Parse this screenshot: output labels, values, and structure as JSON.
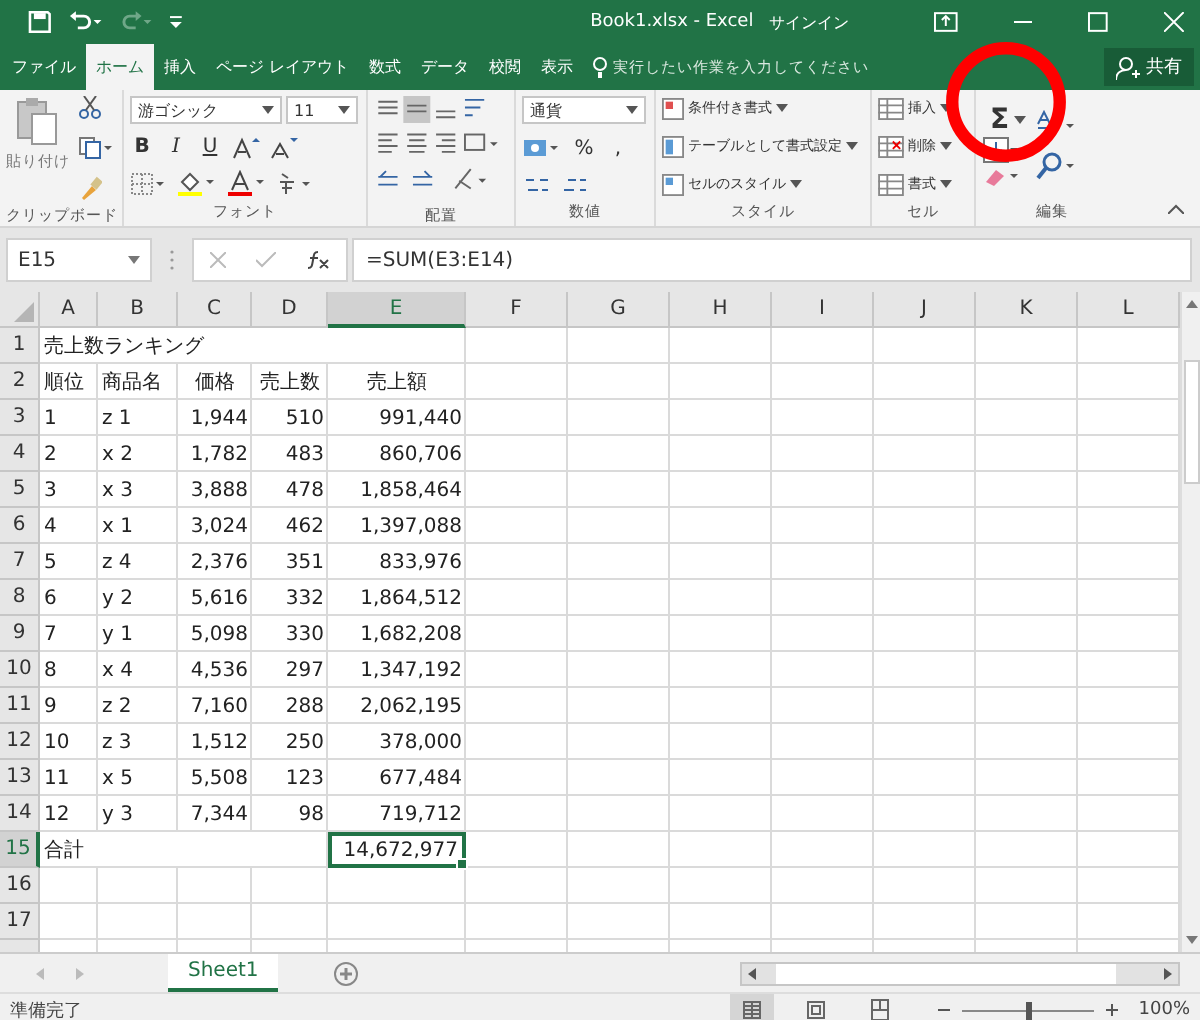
{
  "title_bar": {
    "title": "Book1.xlsx - Excel",
    "signin": "サインイン"
  },
  "ribbon_tabs": [
    {
      "label": "ファイル",
      "selected": false
    },
    {
      "label": "ホーム",
      "selected": true
    },
    {
      "label": "挿入",
      "selected": false
    },
    {
      "label": "ページ レイアウト",
      "selected": false
    },
    {
      "label": "数式",
      "selected": false
    },
    {
      "label": "データ",
      "selected": false
    },
    {
      "label": "校閲",
      "selected": false
    },
    {
      "label": "表示",
      "selected": false
    }
  ],
  "tell_me": {
    "placeholder": "実行したい作業を入力してください"
  },
  "share_button": "共有",
  "clipboard": {
    "paste": "貼り付け",
    "label": "クリップボード"
  },
  "font": {
    "name": "游ゴシック",
    "size": "11",
    "bold": "B",
    "italic": "I",
    "underline": "U",
    "label": "フォント"
  },
  "alignment": {
    "label": "配置"
  },
  "number": {
    "format": "通貨",
    "percent": "%",
    "comma": ",",
    "label": "数値"
  },
  "styles": {
    "items": [
      "条件付き書式",
      "テーブルとして書式設定",
      "セルのスタイル"
    ],
    "label": "スタイル"
  },
  "cells": {
    "items": [
      "挿入",
      "削除",
      "書式"
    ],
    "label": "セル"
  },
  "editing": {
    "autosum": "Σ",
    "label": "編集"
  },
  "formula_bar": {
    "name_box": "E15",
    "formula": "=SUM(E3:E14)"
  },
  "columns": [
    {
      "label": "A",
      "selected": false
    },
    {
      "label": "B",
      "selected": false
    },
    {
      "label": "C",
      "selected": false
    },
    {
      "label": "D",
      "selected": false
    },
    {
      "label": "E",
      "selected": true
    },
    {
      "label": "F",
      "selected": false
    },
    {
      "label": "G",
      "selected": false
    },
    {
      "label": "H",
      "selected": false
    },
    {
      "label": "I",
      "selected": false
    },
    {
      "label": "J",
      "selected": false
    },
    {
      "label": "K",
      "selected": false
    },
    {
      "label": "L",
      "selected": false
    }
  ],
  "rows": [
    {
      "header": "1",
      "kind": "title",
      "selected": false,
      "cells": {
        "A": "売上数ランキング"
      }
    },
    {
      "header": "2",
      "kind": "header",
      "selected": false,
      "cells": {
        "A": "順位",
        "B": "商品名",
        "C": "価格",
        "D": "売上数",
        "E": "売上額"
      }
    },
    {
      "header": "3",
      "kind": "data",
      "selected": false,
      "cells": {
        "A": "1",
        "B": "z 1",
        "C": "1,944",
        "D": "510",
        "E": "991,440"
      }
    },
    {
      "header": "4",
      "kind": "data",
      "selected": false,
      "cells": {
        "A": "2",
        "B": "x 2",
        "C": "1,782",
        "D": "483",
        "E": "860,706"
      }
    },
    {
      "header": "5",
      "kind": "data",
      "selected": false,
      "cells": {
        "A": "3",
        "B": "x 3",
        "C": "3,888",
        "D": "478",
        "E": "1,858,464"
      }
    },
    {
      "header": "6",
      "kind": "data",
      "selected": false,
      "cells": {
        "A": "4",
        "B": "x 1",
        "C": "3,024",
        "D": "462",
        "E": "1,397,088"
      }
    },
    {
      "header": "7",
      "kind": "data",
      "selected": false,
      "cells": {
        "A": "5",
        "B": "z 4",
        "C": "2,376",
        "D": "351",
        "E": "833,976"
      }
    },
    {
      "header": "8",
      "kind": "data",
      "selected": false,
      "cells": {
        "A": "6",
        "B": "y 2",
        "C": "5,616",
        "D": "332",
        "E": "1,864,512"
      }
    },
    {
      "header": "9",
      "kind": "data",
      "selected": false,
      "cells": {
        "A": "7",
        "B": "y 1",
        "C": "5,098",
        "D": "330",
        "E": "1,682,208"
      }
    },
    {
      "header": "10",
      "kind": "data",
      "selected": false,
      "cells": {
        "A": "8",
        "B": "x 4",
        "C": "4,536",
        "D": "297",
        "E": "1,347,192"
      }
    },
    {
      "header": "11",
      "kind": "data",
      "selected": false,
      "cells": {
        "A": "9",
        "B": "z 2",
        "C": "7,160",
        "D": "288",
        "E": "2,062,195"
      }
    },
    {
      "header": "12",
      "kind": "data",
      "selected": false,
      "cells": {
        "A": "10",
        "B": "z 3",
        "C": "1,512",
        "D": "250",
        "E": "378,000"
      }
    },
    {
      "header": "13",
      "kind": "data",
      "selected": false,
      "cells": {
        "A": "11",
        "B": "x 5",
        "C": "5,508",
        "D": "123",
        "E": "677,484"
      }
    },
    {
      "header": "14",
      "kind": "data",
      "selected": false,
      "cells": {
        "A": "12",
        "B": "y 3",
        "C": "7,344",
        "D": "98",
        "E": "719,712"
      }
    },
    {
      "header": "15",
      "kind": "total",
      "selected": true,
      "cells": {
        "A": "合計",
        "E": "14,672,977"
      }
    },
    {
      "header": "16",
      "kind": "empty",
      "selected": false,
      "cells": {}
    },
    {
      "header": "17",
      "kind": "empty",
      "selected": false,
      "cells": {}
    }
  ],
  "sheet_tabs": [
    {
      "label": "Sheet1",
      "selected": true
    }
  ],
  "status_bar": {
    "text": "準備完了",
    "zoom": "100%",
    "zoom_slider": {
      "level": 0.5
    }
  },
  "annotation": {
    "kind": "circle"
  }
}
